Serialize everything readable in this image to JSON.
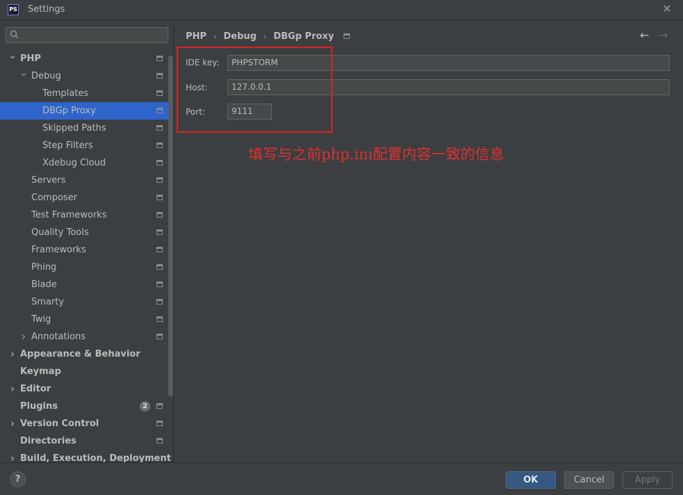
{
  "window": {
    "title": "Settings",
    "app_icon_text": "PS"
  },
  "sidebar": {
    "search": {
      "value": "",
      "placeholder": ""
    },
    "items": [
      {
        "label": "PHP",
        "level": 0,
        "arrow": "down",
        "bold": true,
        "icon": true
      },
      {
        "label": "Debug",
        "level": 1,
        "arrow": "down",
        "bold": false,
        "icon": true
      },
      {
        "label": "Templates",
        "level": 2,
        "arrow": "",
        "bold": false,
        "icon": true
      },
      {
        "label": "DBGp Proxy",
        "level": 2,
        "arrow": "",
        "bold": false,
        "icon": true,
        "selected": true
      },
      {
        "label": "Skipped Paths",
        "level": 2,
        "arrow": "",
        "bold": false,
        "icon": true
      },
      {
        "label": "Step Filters",
        "level": 2,
        "arrow": "",
        "bold": false,
        "icon": true
      },
      {
        "label": "Xdebug Cloud",
        "level": 2,
        "arrow": "",
        "bold": false,
        "icon": true
      },
      {
        "label": "Servers",
        "level": 1,
        "arrow": "",
        "bold": false,
        "icon": true
      },
      {
        "label": "Composer",
        "level": 1,
        "arrow": "",
        "bold": false,
        "icon": true
      },
      {
        "label": "Test Frameworks",
        "level": 1,
        "arrow": "",
        "bold": false,
        "icon": true
      },
      {
        "label": "Quality Tools",
        "level": 1,
        "arrow": "",
        "bold": false,
        "icon": true
      },
      {
        "label": "Frameworks",
        "level": 1,
        "arrow": "",
        "bold": false,
        "icon": true
      },
      {
        "label": "Phing",
        "level": 1,
        "arrow": "",
        "bold": false,
        "icon": true
      },
      {
        "label": "Blade",
        "level": 1,
        "arrow": "",
        "bold": false,
        "icon": true
      },
      {
        "label": "Smarty",
        "level": 1,
        "arrow": "",
        "bold": false,
        "icon": true
      },
      {
        "label": "Twig",
        "level": 1,
        "arrow": "",
        "bold": false,
        "icon": true
      },
      {
        "label": "Annotations",
        "level": 1,
        "arrow": "right",
        "bold": false,
        "icon": true
      },
      {
        "label": "Appearance & Behavior",
        "level": 0,
        "arrow": "right",
        "bold": true,
        "icon": false
      },
      {
        "label": "Keymap",
        "level": 0,
        "arrow": "",
        "bold": true,
        "icon": false
      },
      {
        "label": "Editor",
        "level": 0,
        "arrow": "right",
        "bold": true,
        "icon": false
      },
      {
        "label": "Plugins",
        "level": 0,
        "arrow": "",
        "bold": true,
        "icon": true,
        "badge": "2"
      },
      {
        "label": "Version Control",
        "level": 0,
        "arrow": "right",
        "bold": true,
        "icon": true
      },
      {
        "label": "Directories",
        "level": 0,
        "arrow": "",
        "bold": true,
        "icon": true
      },
      {
        "label": "Build, Execution, Deployment",
        "level": 0,
        "arrow": "right",
        "bold": true,
        "icon": false
      }
    ]
  },
  "breadcrumb": [
    "PHP",
    "Debug",
    "DBGp Proxy"
  ],
  "form": {
    "ide_key": {
      "label": "IDE key:",
      "value": "PHPSTORM"
    },
    "host": {
      "label": "Host:",
      "value": "127.0.0.1"
    },
    "port": {
      "label": "Port:",
      "value": "9111"
    }
  },
  "annotation": "填写与之前php.ini配置内容一致的信息",
  "buttons": {
    "help": "?",
    "ok": "OK",
    "cancel": "Cancel",
    "apply": "Apply"
  },
  "colors": {
    "selection": "#2f65ca",
    "annotation_red": "#e02020",
    "ok_button": "#365880"
  }
}
